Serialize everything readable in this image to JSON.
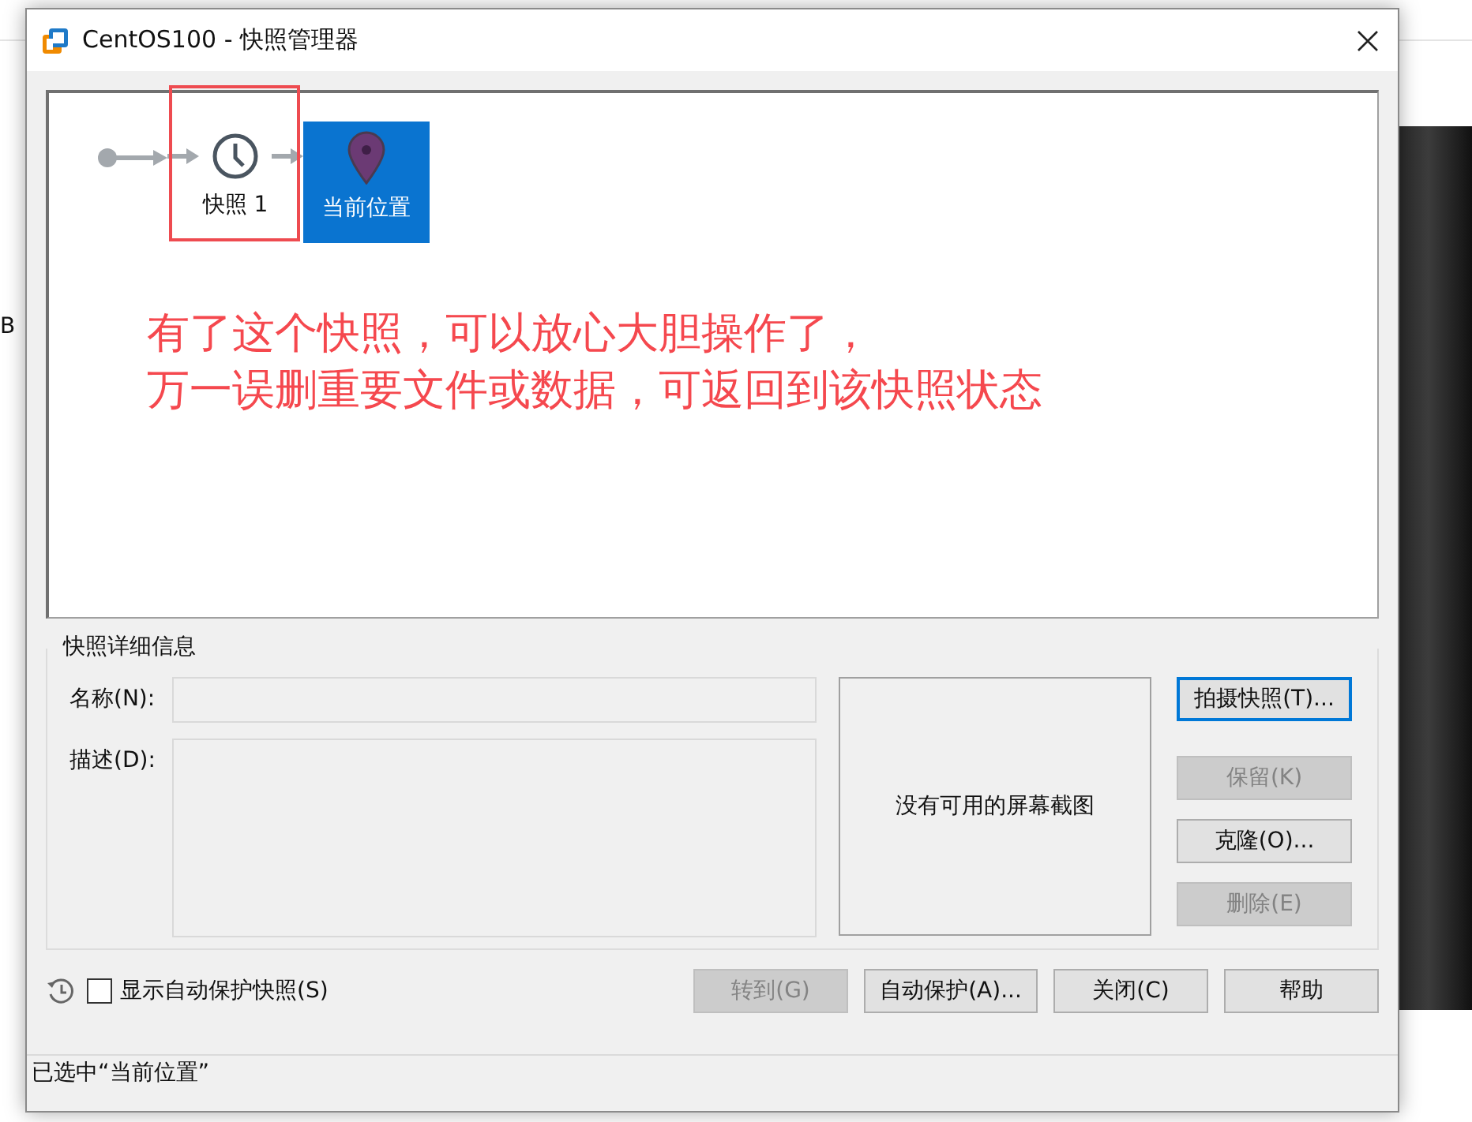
{
  "background": {
    "side_text": "B"
  },
  "window": {
    "title": "CentOS100 - 快照管理器"
  },
  "snapshot_tree": {
    "nodes": [
      {
        "kind": "root"
      },
      {
        "kind": "snapshot",
        "label": "快照 1",
        "selected": false
      },
      {
        "kind": "current",
        "label": "当前位置",
        "selected": true
      }
    ]
  },
  "annotation": {
    "lines": [
      "有了这个快照，可以放心大胆操作了，",
      "万一误删重要文件或数据，可返回到该快照状态"
    ]
  },
  "details": {
    "title": "快照详细信息",
    "name_label": "名称(N):",
    "description_label": "描述(D):",
    "screenshot_text": "没有可用的屏幕截图"
  },
  "side_buttons": [
    {
      "label": "拍摄快照(T)...",
      "disabled": false,
      "focused": true
    },
    {
      "label": "保留(K)",
      "disabled": true,
      "focused": false
    },
    {
      "label": "克隆(O)...",
      "disabled": false,
      "focused": false
    },
    {
      "label": "删除(E)",
      "disabled": true,
      "focused": false
    }
  ],
  "auto_protect": {
    "label": "显示自动保护快照(S)",
    "checked": false
  },
  "bottom_buttons": [
    {
      "label": "转到(G)",
      "disabled": true
    },
    {
      "label": "自动保护(A)...",
      "disabled": false
    },
    {
      "label": "关闭(C)",
      "disabled": false
    },
    {
      "label": "帮助",
      "disabled": false
    }
  ],
  "status_bar": "已选中“当前位置”"
}
